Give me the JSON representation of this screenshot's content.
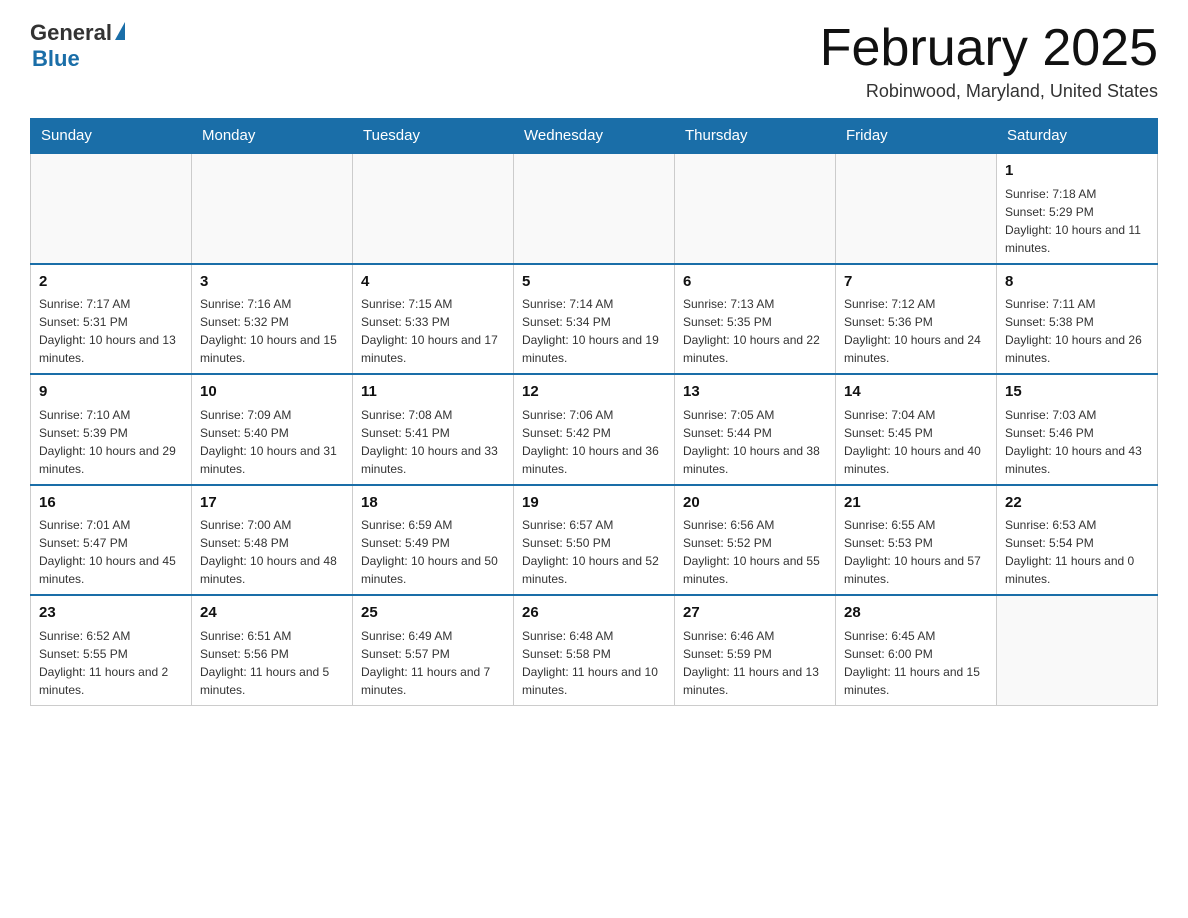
{
  "header": {
    "logo": {
      "general": "General",
      "blue": "Blue"
    },
    "title": "February 2025",
    "subtitle": "Robinwood, Maryland, United States"
  },
  "days_of_week": [
    "Sunday",
    "Monday",
    "Tuesday",
    "Wednesday",
    "Thursday",
    "Friday",
    "Saturday"
  ],
  "weeks": [
    {
      "days": [
        {
          "number": "",
          "sunrise": "",
          "sunset": "",
          "daylight": ""
        },
        {
          "number": "",
          "sunrise": "",
          "sunset": "",
          "daylight": ""
        },
        {
          "number": "",
          "sunrise": "",
          "sunset": "",
          "daylight": ""
        },
        {
          "number": "",
          "sunrise": "",
          "sunset": "",
          "daylight": ""
        },
        {
          "number": "",
          "sunrise": "",
          "sunset": "",
          "daylight": ""
        },
        {
          "number": "",
          "sunrise": "",
          "sunset": "",
          "daylight": ""
        },
        {
          "number": "1",
          "sunrise": "Sunrise: 7:18 AM",
          "sunset": "Sunset: 5:29 PM",
          "daylight": "Daylight: 10 hours and 11 minutes."
        }
      ]
    },
    {
      "days": [
        {
          "number": "2",
          "sunrise": "Sunrise: 7:17 AM",
          "sunset": "Sunset: 5:31 PM",
          "daylight": "Daylight: 10 hours and 13 minutes."
        },
        {
          "number": "3",
          "sunrise": "Sunrise: 7:16 AM",
          "sunset": "Sunset: 5:32 PM",
          "daylight": "Daylight: 10 hours and 15 minutes."
        },
        {
          "number": "4",
          "sunrise": "Sunrise: 7:15 AM",
          "sunset": "Sunset: 5:33 PM",
          "daylight": "Daylight: 10 hours and 17 minutes."
        },
        {
          "number": "5",
          "sunrise": "Sunrise: 7:14 AM",
          "sunset": "Sunset: 5:34 PM",
          "daylight": "Daylight: 10 hours and 19 minutes."
        },
        {
          "number": "6",
          "sunrise": "Sunrise: 7:13 AM",
          "sunset": "Sunset: 5:35 PM",
          "daylight": "Daylight: 10 hours and 22 minutes."
        },
        {
          "number": "7",
          "sunrise": "Sunrise: 7:12 AM",
          "sunset": "Sunset: 5:36 PM",
          "daylight": "Daylight: 10 hours and 24 minutes."
        },
        {
          "number": "8",
          "sunrise": "Sunrise: 7:11 AM",
          "sunset": "Sunset: 5:38 PM",
          "daylight": "Daylight: 10 hours and 26 minutes."
        }
      ]
    },
    {
      "days": [
        {
          "number": "9",
          "sunrise": "Sunrise: 7:10 AM",
          "sunset": "Sunset: 5:39 PM",
          "daylight": "Daylight: 10 hours and 29 minutes."
        },
        {
          "number": "10",
          "sunrise": "Sunrise: 7:09 AM",
          "sunset": "Sunset: 5:40 PM",
          "daylight": "Daylight: 10 hours and 31 minutes."
        },
        {
          "number": "11",
          "sunrise": "Sunrise: 7:08 AM",
          "sunset": "Sunset: 5:41 PM",
          "daylight": "Daylight: 10 hours and 33 minutes."
        },
        {
          "number": "12",
          "sunrise": "Sunrise: 7:06 AM",
          "sunset": "Sunset: 5:42 PM",
          "daylight": "Daylight: 10 hours and 36 minutes."
        },
        {
          "number": "13",
          "sunrise": "Sunrise: 7:05 AM",
          "sunset": "Sunset: 5:44 PM",
          "daylight": "Daylight: 10 hours and 38 minutes."
        },
        {
          "number": "14",
          "sunrise": "Sunrise: 7:04 AM",
          "sunset": "Sunset: 5:45 PM",
          "daylight": "Daylight: 10 hours and 40 minutes."
        },
        {
          "number": "15",
          "sunrise": "Sunrise: 7:03 AM",
          "sunset": "Sunset: 5:46 PM",
          "daylight": "Daylight: 10 hours and 43 minutes."
        }
      ]
    },
    {
      "days": [
        {
          "number": "16",
          "sunrise": "Sunrise: 7:01 AM",
          "sunset": "Sunset: 5:47 PM",
          "daylight": "Daylight: 10 hours and 45 minutes."
        },
        {
          "number": "17",
          "sunrise": "Sunrise: 7:00 AM",
          "sunset": "Sunset: 5:48 PM",
          "daylight": "Daylight: 10 hours and 48 minutes."
        },
        {
          "number": "18",
          "sunrise": "Sunrise: 6:59 AM",
          "sunset": "Sunset: 5:49 PM",
          "daylight": "Daylight: 10 hours and 50 minutes."
        },
        {
          "number": "19",
          "sunrise": "Sunrise: 6:57 AM",
          "sunset": "Sunset: 5:50 PM",
          "daylight": "Daylight: 10 hours and 52 minutes."
        },
        {
          "number": "20",
          "sunrise": "Sunrise: 6:56 AM",
          "sunset": "Sunset: 5:52 PM",
          "daylight": "Daylight: 10 hours and 55 minutes."
        },
        {
          "number": "21",
          "sunrise": "Sunrise: 6:55 AM",
          "sunset": "Sunset: 5:53 PM",
          "daylight": "Daylight: 10 hours and 57 minutes."
        },
        {
          "number": "22",
          "sunrise": "Sunrise: 6:53 AM",
          "sunset": "Sunset: 5:54 PM",
          "daylight": "Daylight: 11 hours and 0 minutes."
        }
      ]
    },
    {
      "days": [
        {
          "number": "23",
          "sunrise": "Sunrise: 6:52 AM",
          "sunset": "Sunset: 5:55 PM",
          "daylight": "Daylight: 11 hours and 2 minutes."
        },
        {
          "number": "24",
          "sunrise": "Sunrise: 6:51 AM",
          "sunset": "Sunset: 5:56 PM",
          "daylight": "Daylight: 11 hours and 5 minutes."
        },
        {
          "number": "25",
          "sunrise": "Sunrise: 6:49 AM",
          "sunset": "Sunset: 5:57 PM",
          "daylight": "Daylight: 11 hours and 7 minutes."
        },
        {
          "number": "26",
          "sunrise": "Sunrise: 6:48 AM",
          "sunset": "Sunset: 5:58 PM",
          "daylight": "Daylight: 11 hours and 10 minutes."
        },
        {
          "number": "27",
          "sunrise": "Sunrise: 6:46 AM",
          "sunset": "Sunset: 5:59 PM",
          "daylight": "Daylight: 11 hours and 13 minutes."
        },
        {
          "number": "28",
          "sunrise": "Sunrise: 6:45 AM",
          "sunset": "Sunset: 6:00 PM",
          "daylight": "Daylight: 11 hours and 15 minutes."
        },
        {
          "number": "",
          "sunrise": "",
          "sunset": "",
          "daylight": ""
        }
      ]
    }
  ]
}
